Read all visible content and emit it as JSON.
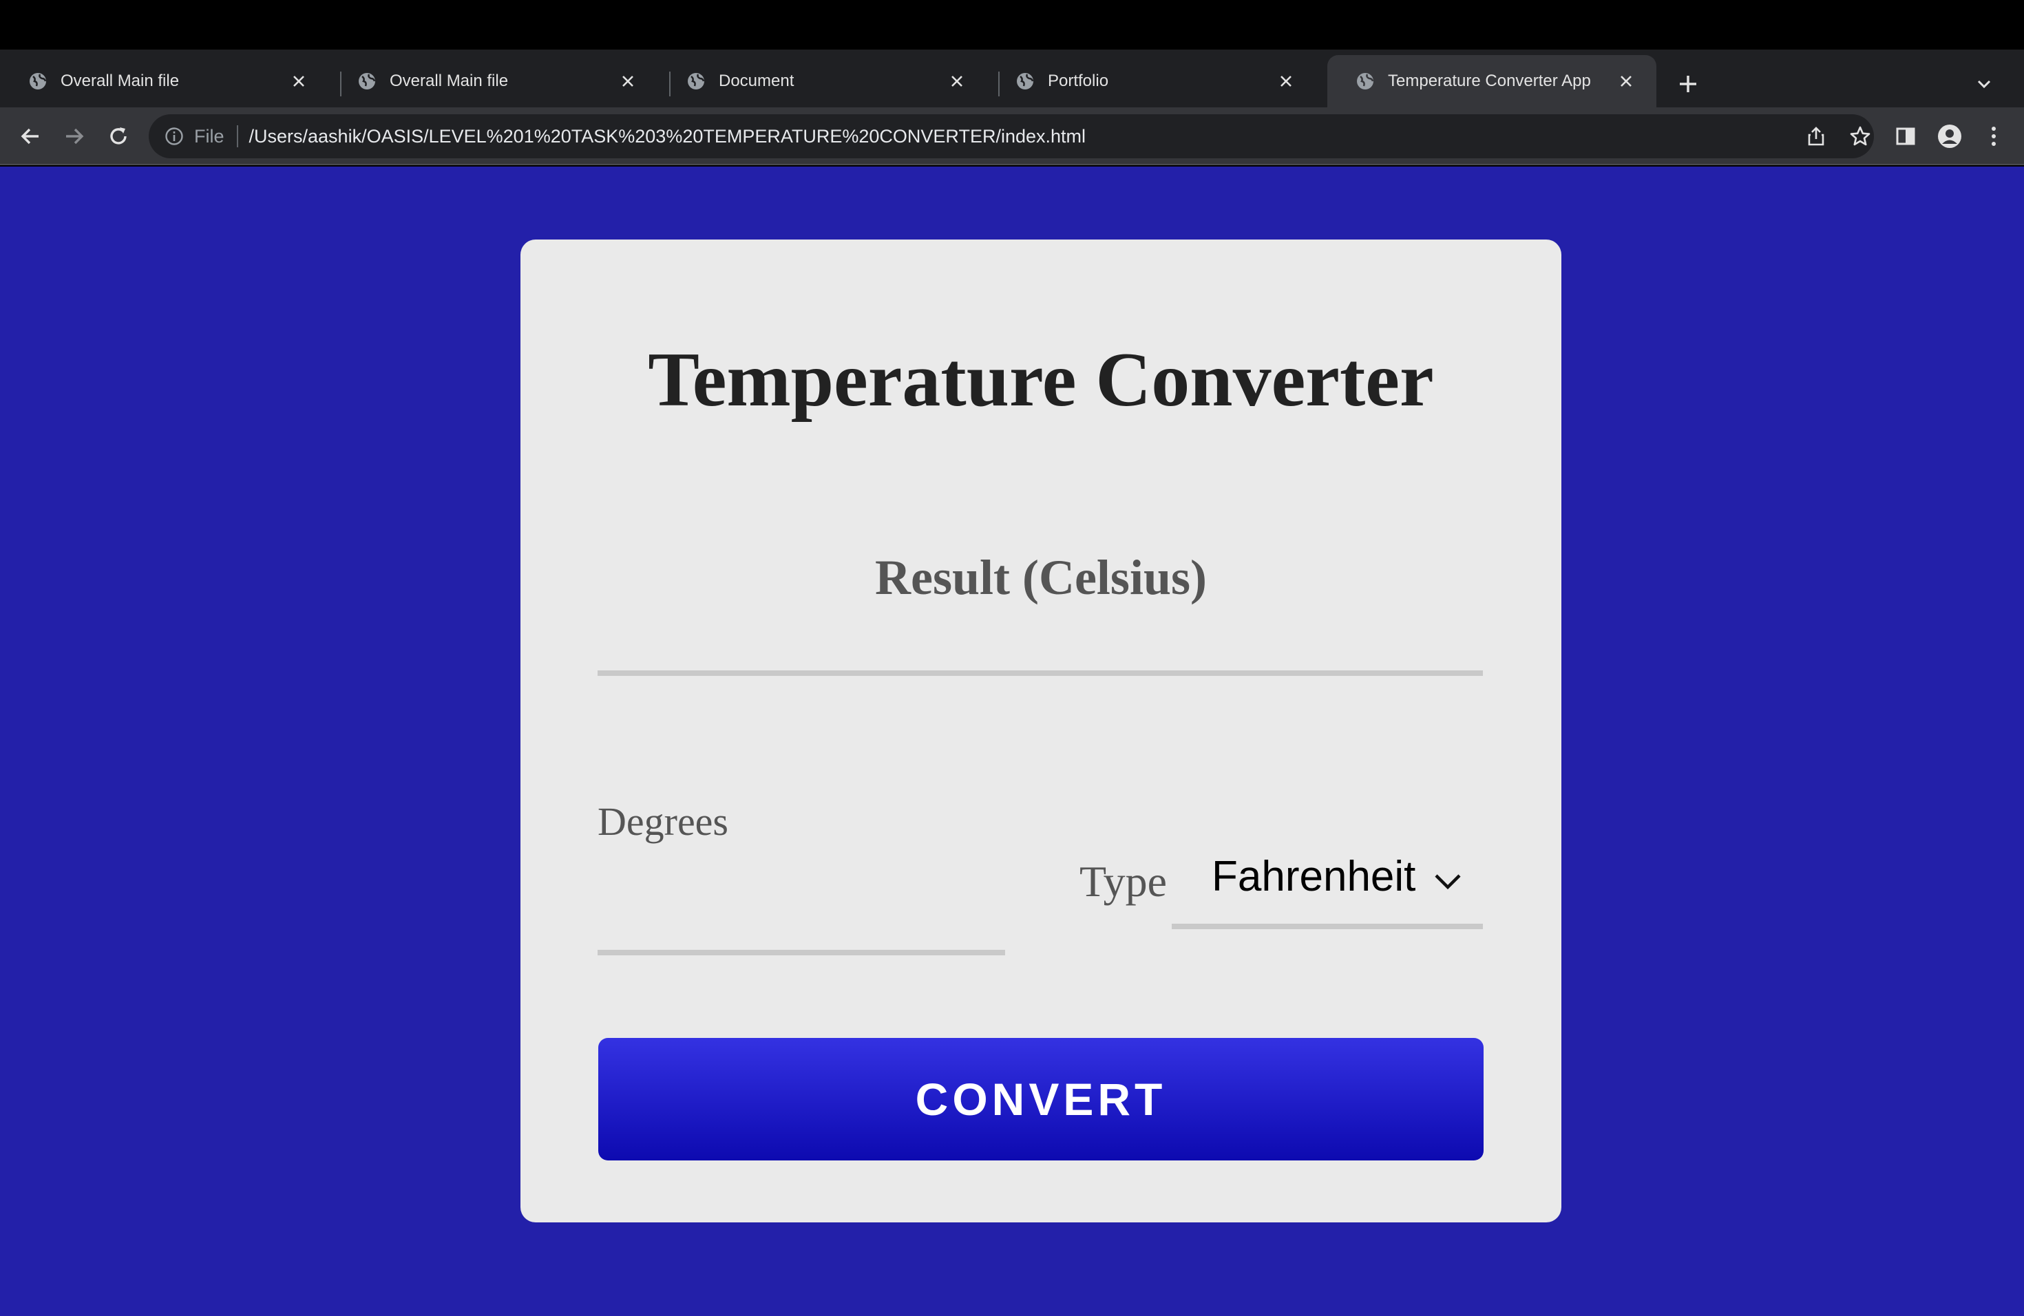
{
  "browser": {
    "tabs": [
      {
        "title": "Overall Main file",
        "icon": "globe-icon",
        "active": false
      },
      {
        "title": "Overall Main file",
        "icon": "globe-icon",
        "active": false
      },
      {
        "title": "Document",
        "icon": "globe-icon",
        "active": false
      },
      {
        "title": "Portfolio",
        "icon": "globe-icon",
        "active": false
      },
      {
        "title": "Temperature Converter App",
        "icon": "globe-icon",
        "active": true
      }
    ],
    "address_bar": {
      "scheme_label": "File",
      "url": "/Users/aashik/OASIS/LEVEL%201%20TASK%203%20TEMPERATURE%20CONVERTER/index.html"
    }
  },
  "page": {
    "background_color": "#2320a9",
    "title": "Temperature Converter",
    "result_label": "Result (Celsius)",
    "degrees_label": "Degrees",
    "degrees_value": "",
    "type_label": "Type",
    "type_selected": "Fahrenheit",
    "convert_label": "CONVERT",
    "button_color": "#2321d0"
  }
}
